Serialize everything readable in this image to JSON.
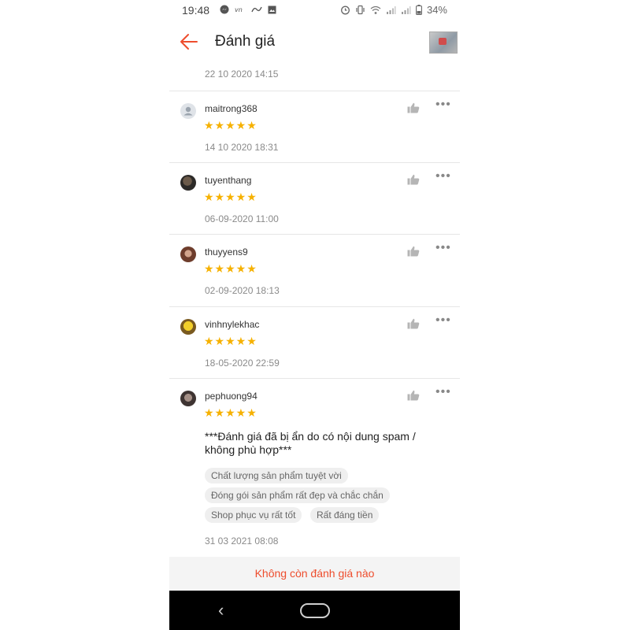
{
  "status_bar": {
    "time": "19:48",
    "battery": "34%",
    "left_icons": [
      "messenger-icon",
      "vn-icon",
      "signal-app-icon",
      "image-icon"
    ],
    "right_icons": [
      "alarm-icon",
      "vibrate-icon",
      "wifi-icon",
      "cell-signal-icon",
      "cell-signal-icon",
      "battery-icon"
    ]
  },
  "header": {
    "title": "Đánh giá",
    "back_icon": "back-arrow-icon",
    "accent_color": "#ee4d2d"
  },
  "top_date": "22 10 2020 14:15",
  "reviews": [
    {
      "username": "maitrong368",
      "stars": "★★★★★",
      "rating": 5,
      "date": "14 10 2020 18:31",
      "avatar": "default-user"
    },
    {
      "username": "tuyenthang",
      "stars": "★★★★★",
      "rating": 5,
      "date": "06-09-2020 11:00",
      "avatar": "photo"
    },
    {
      "username": "thuyyens9",
      "stars": "★★★★★",
      "rating": 5,
      "date": "02-09-2020 18:13",
      "avatar": "photo"
    },
    {
      "username": "vinhnylekhac",
      "stars": "★★★★★",
      "rating": 5,
      "date": "18-05-2020 22:59",
      "avatar": "photo"
    },
    {
      "username": "pephuong94",
      "stars": "★★★★★",
      "rating": 5,
      "date": "31 03 2021 08:08",
      "avatar": "photo",
      "comment": "***Đánh giá đã bị ẩn do có nội dung spam / không phù hợp***",
      "tags": [
        "Chất lượng sản phẩm tuyệt vời",
        "Đóng gói sản phẩm rất đẹp và chắc chắn",
        "Shop phục vụ rất tốt",
        "Rất đáng tiền"
      ]
    }
  ],
  "footer": {
    "message": "Không còn đánh giá nào"
  },
  "nav": {
    "back_icon": "nav-back-icon",
    "home_icon": "nav-home-icon"
  }
}
